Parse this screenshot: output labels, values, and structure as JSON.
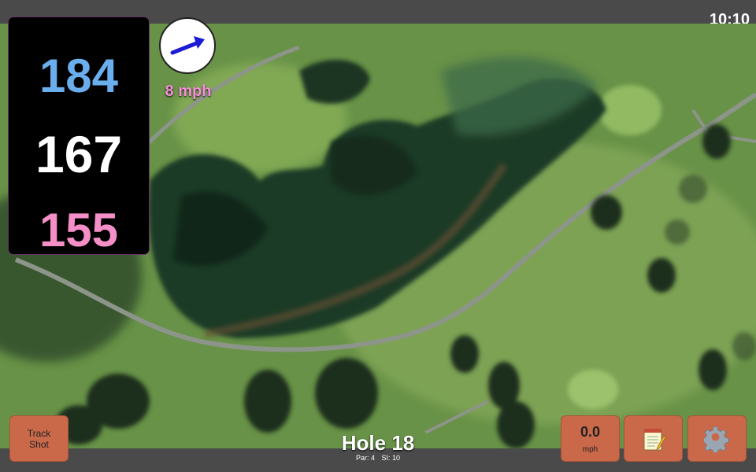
{
  "status": {
    "time": "10:10"
  },
  "distances": {
    "back": "184",
    "center": "167",
    "front": "155"
  },
  "wind": {
    "speed_label": "8 mph",
    "direction_icon": "arrow-icon"
  },
  "hole": {
    "title": "Hole 18",
    "par_label": "Par: 4",
    "si_label": "SI: 10"
  },
  "buttons": {
    "track_shot_line1": "Track",
    "track_shot_line2": "Shot",
    "speed_value": "0.0",
    "speed_unit": "mph",
    "notes_icon": "notepad-icon",
    "settings_icon": "gear-icon"
  },
  "colors": {
    "back_distance": "#6aaeee",
    "center_distance": "#ffffff",
    "front_distance": "#f48fc8",
    "wind_label": "#f48fd8",
    "button": "#c9694a"
  }
}
